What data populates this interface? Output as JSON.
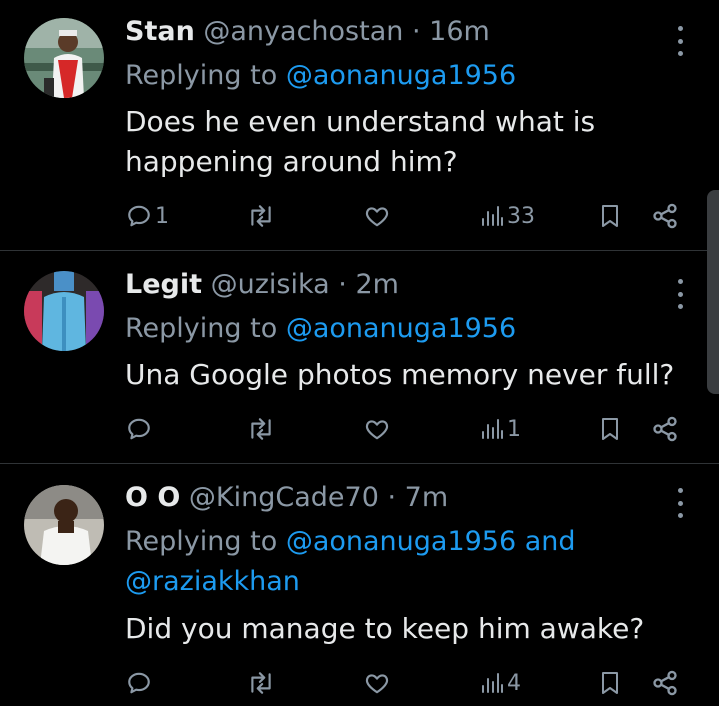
{
  "tweets": [
    {
      "name": "Stan",
      "handle": "@anyachostan",
      "dot": "·",
      "time": "16m",
      "replying_prefix": "Replying to",
      "mention": "@aonanuga1956",
      "text": "Does he even understand what is happening around him?",
      "counts": {
        "replies": "1",
        "reposts": "",
        "likes": "",
        "views": "33"
      }
    },
    {
      "name": "Legit",
      "handle": "@uzisika",
      "dot": "·",
      "time": "2m",
      "replying_prefix": "Replying to",
      "mention": "@aonanuga1956",
      "text": "Una Google photos memory never full?",
      "counts": {
        "replies": "",
        "reposts": "",
        "likes": "",
        "views": "1"
      }
    },
    {
      "name": "O O",
      "handle": "@KingCade70",
      "dot": "·",
      "time": "7m",
      "replying_prefix": "Replying to",
      "mention": "@aonanuga1956",
      "and": "and",
      "mention2": "@raziakkhan",
      "text": "Did you manage to keep him awake?",
      "counts": {
        "replies": "",
        "reposts": "",
        "likes": "",
        "views": "4"
      }
    }
  ],
  "icons": {
    "reply": "reply-icon",
    "repost": "repost-icon",
    "like": "heart-icon",
    "views": "views-icon",
    "bookmark": "bookmark-icon",
    "share": "share-icon",
    "more": "more-vertical-icon"
  },
  "colors": {
    "background": "#000000",
    "text": "#e7e9ea",
    "muted": "#8b98a5",
    "link": "#1d9bf0",
    "divider": "#2f3336"
  }
}
